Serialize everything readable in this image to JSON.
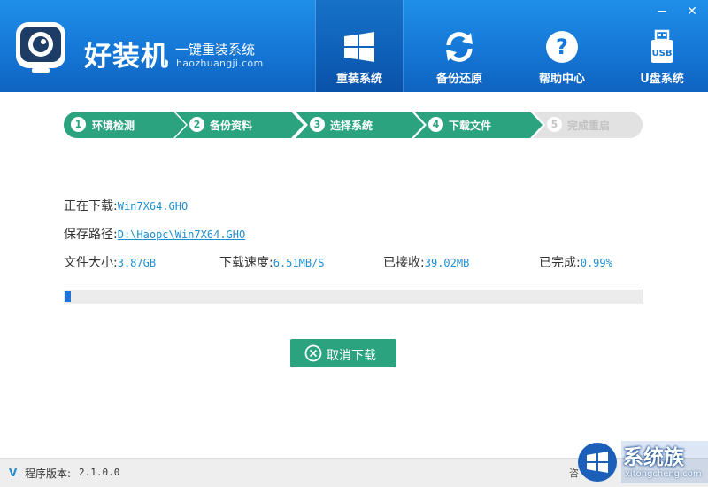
{
  "app": {
    "brand": "好装机",
    "slogan": "一键重装系统",
    "domain": "haozhuangji.com"
  },
  "nav": [
    {
      "label": "重装系统",
      "icon": "windows-logo-icon",
      "active": true
    },
    {
      "label": "备份还原",
      "icon": "refresh-arrows-icon",
      "active": false
    },
    {
      "label": "帮助中心",
      "icon": "help-question-icon",
      "active": false
    },
    {
      "label": "U盘系统",
      "icon": "usb-drive-icon",
      "active": false
    }
  ],
  "window_controls": {
    "minimize": "−",
    "close": "✕"
  },
  "steps": [
    {
      "num": "1",
      "label": "环境检测",
      "done": true
    },
    {
      "num": "2",
      "label": "备份资料",
      "done": true
    },
    {
      "num": "3",
      "label": "选择系统",
      "done": true
    },
    {
      "num": "4",
      "label": "下载文件",
      "done": true
    },
    {
      "num": "5",
      "label": "完成重启",
      "done": false
    }
  ],
  "download": {
    "downloading_label": "正在下载:",
    "downloading_file": "Win7X64.GHO",
    "path_label": "保存路径:",
    "path_value": "D:\\Haopc\\Win7X64.GHO",
    "size_label": "文件大小:",
    "size_value": "3.87GB",
    "speed_label": "下载速度:",
    "speed_value": "6.51MB/S",
    "received_label": "已接收:",
    "received_value": "39.02MB",
    "done_label": "已完成:",
    "done_value": "0.99%",
    "progress_fraction": 0.0099
  },
  "cancel_button": "取消下载",
  "footer": {
    "version_icon": "V",
    "version_label": "程序版本:",
    "version_value": "2.1.0.0",
    "consult": "咨"
  },
  "watermark": {
    "text": "系统族",
    "sub": "xitongcheng.com"
  },
  "colors": {
    "header": "#1577d6",
    "step_active": "#2ba37f",
    "step_inactive": "#e2e2e2",
    "progress_fill": "#1f72d6",
    "value_text": "#1f8fd0"
  }
}
